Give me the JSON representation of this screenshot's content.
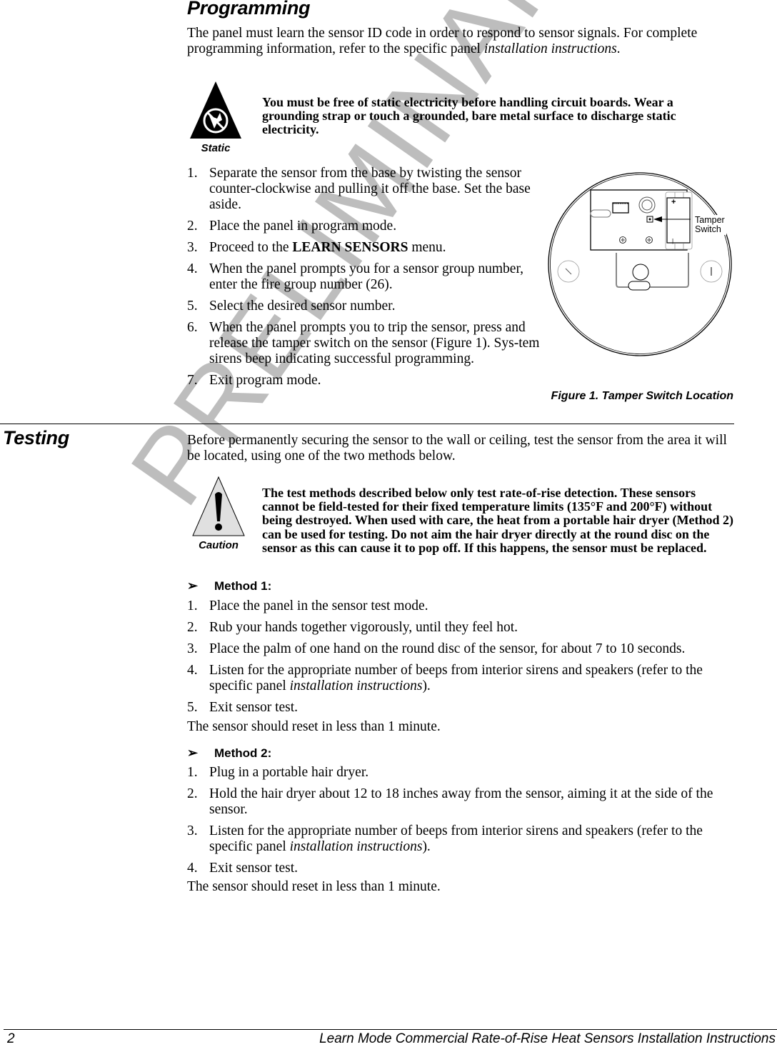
{
  "watermark": "PRELIMINARY",
  "programming": {
    "title": "Programming",
    "intro_plain": "The panel must learn the sensor ID code in order to respond to sensor signals. For complete programming information, refer to the specific panel ",
    "intro_italic": "installation instructions",
    "intro_end": ".",
    "static_icon": {
      "icon": "static-warning-icon",
      "label": "Static"
    },
    "static_note": "You must be free of static electricity before handling circuit boards. Wear a grounding strap or touch a grounded, bare metal surface to discharge static electricity.",
    "steps": [
      {
        "num": "1.",
        "text": "Separate the sensor from the base by twisting the sensor counter-clockwise and pulling it off the base. Set the base aside."
      },
      {
        "num": "2.",
        "text": "Place the panel in program mode."
      },
      {
        "num": "3.",
        "pre": "Proceed to the ",
        "bold": "LEARN SENSORS",
        "post": " menu."
      },
      {
        "num": "4.",
        "text": "When the panel prompts you for a sensor group number, enter the fire group number (26)."
      },
      {
        "num": "5.",
        "text": "Select the desired sensor number."
      },
      {
        "num": "6.",
        "text": "When the panel prompts you to trip the sensor, press and release the tamper switch on the sensor (Figure 1). Sys-tem sirens beep indicating successful programming."
      },
      {
        "num": "7.",
        "text": "Exit program mode."
      }
    ],
    "figure": {
      "callout": [
        "Tamper",
        "Switch"
      ],
      "battery_plus": "+",
      "battery_minus": "|",
      "caption": "Figure 1.  Tamper Switch Location"
    }
  },
  "testing": {
    "title": "Testing",
    "intro": "Before permanently securing the sensor to the wall or ceiling, test the sensor from the area it will be located, using one of the two methods below.",
    "caution_icon": {
      "icon": "caution-warning-icon",
      "label": "Caution"
    },
    "caution_note": "The test methods described below only test rate-of-rise detection. These sensors cannot be field-tested for their fixed temperature limits (135°F and 200°F) without being destroyed. When used with care, the heat from a portable hair dryer (Method 2) can be used for testing. Do not aim the hair dryer directly at the round disc on the sensor as this can cause it to pop off. If this happens, the sensor must be replaced.",
    "method1": {
      "arrow": "➢",
      "heading": "Method 1:",
      "steps": [
        {
          "num": "1.",
          "text": "Place the panel in the sensor test mode."
        },
        {
          "num": "2.",
          "text": "Rub your hands together vigorously, until they feel hot."
        },
        {
          "num": "3.",
          "text": "Place the palm of one hand on the round disc of the sensor, for about 7 to 10 seconds."
        },
        {
          "num": "4.",
          "pre": "Listen for the appropriate number of beeps from interior sirens and speakers (refer to the specific panel ",
          "italic": "installation instructions",
          "post": ")."
        },
        {
          "num": "5.",
          "text": "Exit sensor test."
        }
      ],
      "result": "The sensor should reset in less than 1 minute."
    },
    "method2": {
      "arrow": "➢",
      "heading": "Method 2:",
      "steps": [
        {
          "num": "1.",
          "text": "Plug in a portable hair dryer."
        },
        {
          "num": "2.",
          "text": "Hold the hair dryer about 12 to 18 inches away from the sensor, aiming it at the side of the sensor."
        },
        {
          "num": "3.",
          "pre": "Listen for the appropriate number of beeps from interior sirens and speakers (refer to the specific panel ",
          "italic": "installation instructions",
          "post": ")."
        },
        {
          "num": "4.",
          "text": "Exit sensor test."
        }
      ],
      "result": "The sensor should reset in less than 1 minute."
    }
  },
  "footer": {
    "page_number": "2",
    "doc_title": "Learn Mode Commercial Rate-of-Rise Heat Sensors Installation Instructions"
  }
}
